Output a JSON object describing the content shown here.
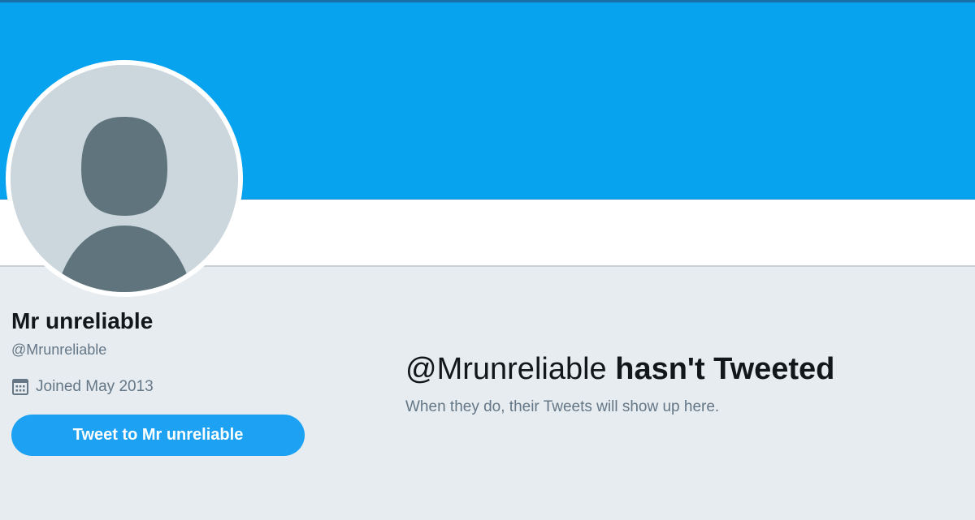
{
  "profile": {
    "name": "Mr unreliable",
    "handle": "@Mrunreliable",
    "joined": "Joined May 2013",
    "tweet_button_label": "Tweet to Mr unreliable"
  },
  "empty_state": {
    "handle": "@Mrunreliable",
    "title_rest": "hasn't Tweeted",
    "subtitle": "When they do, their Tweets will show up here."
  },
  "icons": {
    "calendar": "calendar-icon",
    "avatar": "default-avatar-icon"
  },
  "colors": {
    "banner": "#07a3ef",
    "button": "#1da1f2",
    "background": "#e6ecf0",
    "avatar_bg": "#ccd6dd",
    "avatar_figure": "#5f747c"
  }
}
